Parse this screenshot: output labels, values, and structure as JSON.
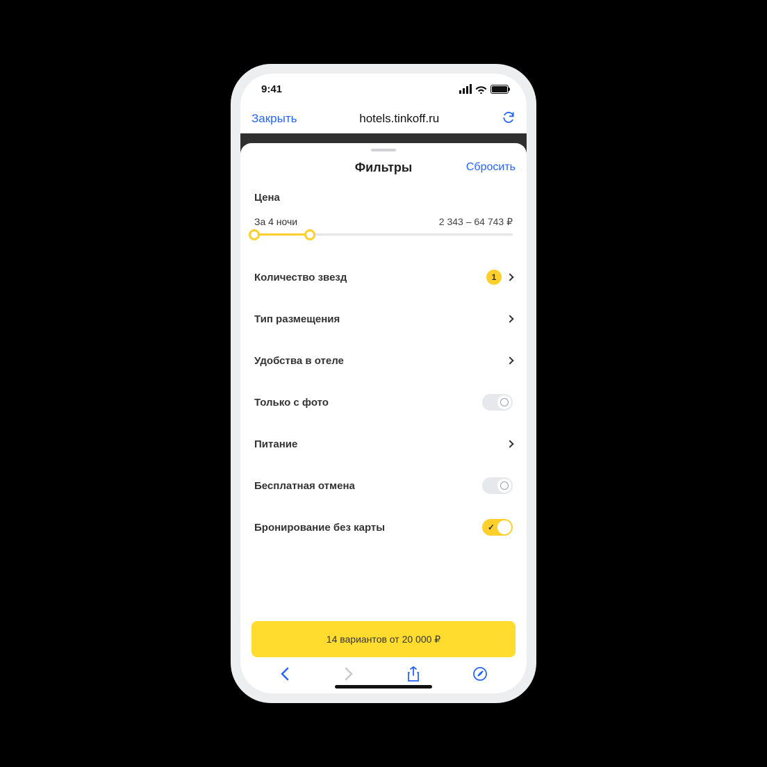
{
  "status": {
    "time": "9:41"
  },
  "browser": {
    "close": "Закрыть",
    "url": "hotels.tinkoff.ru"
  },
  "sheet": {
    "title": "Фильтры",
    "reset": "Сбросить"
  },
  "price": {
    "section_title": "Цена",
    "nights_label": "За 4 ночи",
    "range_text": "2 343 – 64 743 ₽"
  },
  "filters": {
    "stars": {
      "label": "Количество звезд",
      "badge": "1"
    },
    "type": {
      "label": "Тип размещения"
    },
    "amenities": {
      "label": "Удобства в отеле"
    },
    "photo": {
      "label": "Только с фото",
      "on": false
    },
    "meals": {
      "label": "Питание"
    },
    "free_cancel": {
      "label": "Бесплатная отмена",
      "on": false
    },
    "no_card": {
      "label": "Бронирование без карты",
      "on": true
    }
  },
  "results_button": "14 вариантов от 20 000 ₽"
}
